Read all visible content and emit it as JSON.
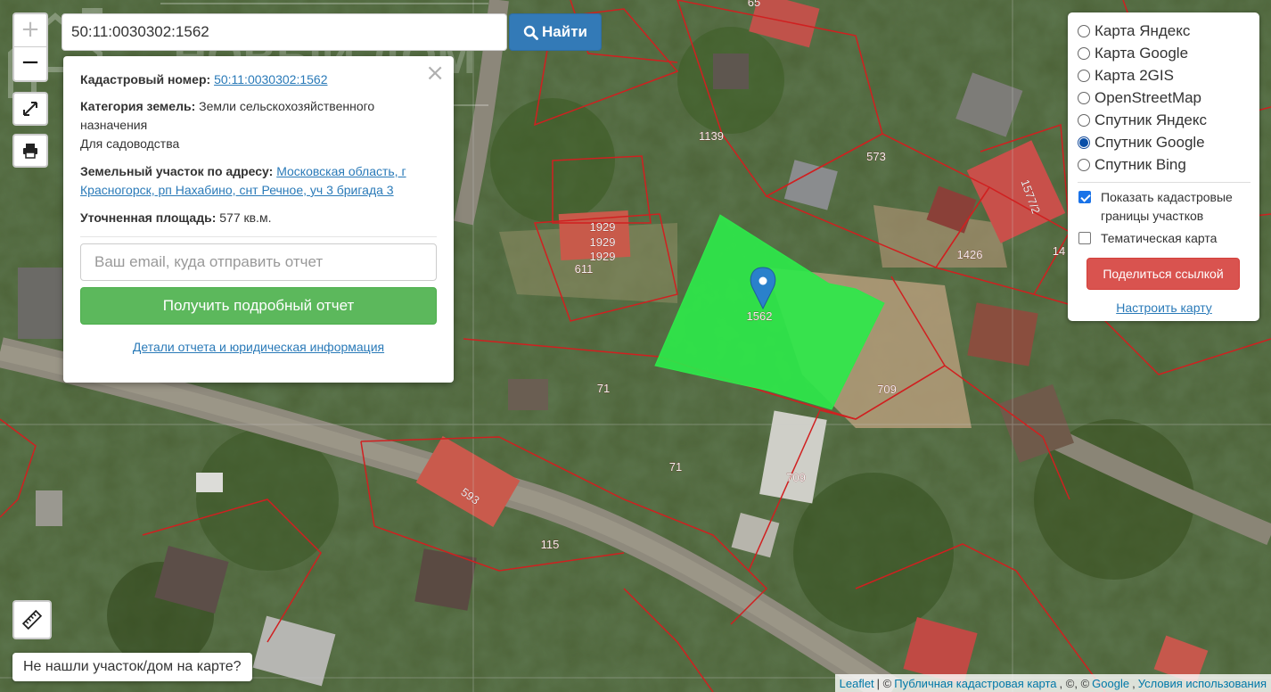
{
  "search": {
    "value": "50:11:0030302:1562",
    "button_label": "Найти"
  },
  "popup": {
    "cadastral_label": "Кадастровый номер:",
    "cadastral_value": "50:11:0030302:1562",
    "category_label": "Категория земель:",
    "category_value": "Земли сельскохозяйственного назначения",
    "use_value": "Для садоводства",
    "address_label": "Земельный участок по адресу:",
    "address_value": "Московская область, г Красногорск, рп Нахабино, снт Речное, уч 3 бригада 3",
    "area_label": "Уточненная площадь:",
    "area_value": "577 кв.м.",
    "email_placeholder": "Ваш email, куда отправить отчет",
    "report_button": "Получить подробный отчет",
    "details_link": "Детали отчета и юридическая информация"
  },
  "layers": {
    "options": [
      {
        "label": "Карта Яндекс",
        "selected": false
      },
      {
        "label": "Карта Google",
        "selected": false
      },
      {
        "label": "Карта 2GIS",
        "selected": false
      },
      {
        "label": "OpenStreetMap",
        "selected": false
      },
      {
        "label": "Спутник Яндекс",
        "selected": false
      },
      {
        "label": "Спутник Google",
        "selected": true
      },
      {
        "label": "Спутник Bing",
        "selected": false
      }
    ],
    "show_borders_label": "Показать кадастровые границы участков",
    "show_borders_checked": true,
    "thematic_label": "Тематическая карта",
    "thematic_checked": false,
    "share_button": "Поделиться ссылкой",
    "setup_link": "Настроить карту"
  },
  "not_found_button": "Не нашли участок/дом на карте?",
  "watermark_text": "НОВЫЙ ДОМ",
  "attribution": {
    "leaflet": "Leaflet",
    "sep1": "| ©",
    "pkk": "Публичная кадастровая карта",
    "sep2": ", ©, ©",
    "google": "Google",
    "terms": "Условия использования"
  },
  "map_labels": [
    {
      "text": "1139"
    },
    {
      "text": "573"
    },
    {
      "text": "573"
    },
    {
      "text": "1929"
    },
    {
      "text": "1929"
    },
    {
      "text": "1929"
    },
    {
      "text": "611"
    },
    {
      "text": "1562"
    },
    {
      "text": "1426"
    },
    {
      "text": "1577/2"
    },
    {
      "text": "14"
    },
    {
      "text": "71"
    },
    {
      "text": "71"
    },
    {
      "text": "709"
    },
    {
      "text": "709"
    },
    {
      "text": "593"
    },
    {
      "text": "115"
    },
    {
      "text": "65"
    }
  ],
  "colors": {
    "parcel_fill": "#2ee84a",
    "boundary": "#d02020",
    "marker": "#2a81cb",
    "primary": "#337ab7",
    "success": "#5cb85c",
    "danger": "#d9534f"
  }
}
